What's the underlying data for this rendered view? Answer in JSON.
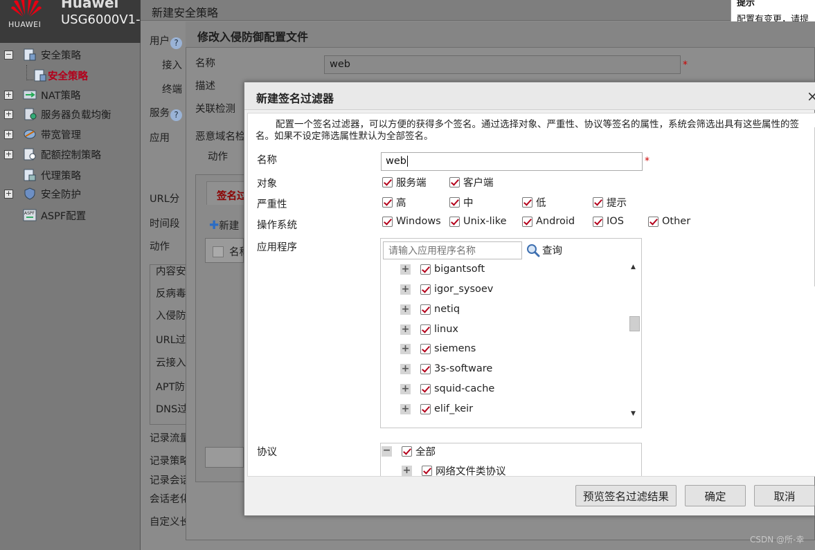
{
  "brand": {
    "logo_text": "HUAWEI",
    "name": "Huawei",
    "model": "USG6000V1-"
  },
  "hint": {
    "title": "提示",
    "text": "配置有变更，请提"
  },
  "sidebar": {
    "items": [
      {
        "label": "安全策略",
        "expand": "−"
      },
      {
        "label": "安全策略"
      },
      {
        "label": "NAT策略",
        "expand": "+"
      },
      {
        "label": "服务器负载均衡",
        "expand": "+"
      },
      {
        "label": "带宽管理",
        "expand": "+"
      },
      {
        "label": "配额控制策略",
        "expand": "+"
      },
      {
        "label": "代理策略"
      },
      {
        "label": "安全防护",
        "expand": "+"
      },
      {
        "label": "ASPF配置"
      }
    ]
  },
  "bg_page": {
    "title": "新建安全策略",
    "labels": [
      "用户",
      "接入",
      "终端",
      "服务",
      "应用",
      "URL分",
      "时间段",
      "动作",
      "内容安",
      "反病毒",
      "入侵防",
      "URL过",
      "云接入",
      "APT防",
      "DNS过",
      "记录流量",
      "记录策略",
      "记录会话",
      "会话老化",
      "自定义长"
    ],
    "help": "?",
    "tab": "签名过",
    "new_btn": "新建",
    "col": "名称"
  },
  "mid_dialog": {
    "title": "修改入侵防御配置文件",
    "labels": [
      "名称",
      "描述",
      "关联检测",
      "恶意域名检",
      "动作"
    ],
    "name_value": "web"
  },
  "dialog": {
    "title": "新建签名过滤器",
    "close": "×",
    "description": "配置一个签名过滤器，可以方便的获得多个签名。通过选择对象、严重性、协议等签名的属性，系统会筛选出具有这些属性的签名。如果不设定筛选属性默认为全部签名。",
    "name_label": "名称",
    "name_value": "web",
    "required": "*",
    "object_label": "对象",
    "objects": [
      "服务端",
      "客户端"
    ],
    "severity_label": "严重性",
    "severities": [
      "高",
      "中",
      "低",
      "提示"
    ],
    "os_label": "操作系统",
    "os": [
      "Windows",
      "Unix-like",
      "Android",
      "IOS",
      "Other"
    ],
    "app_label": "应用程序",
    "app_placeholder": "请输入应用程序名称",
    "search_label": "查询",
    "apps": [
      "bigantsoft",
      "igor_sysoev",
      "netiq",
      "linux",
      "siemens",
      "3s-software",
      "squid-cache",
      "elif_keir"
    ],
    "protocol_label": "协议",
    "protocols": [
      {
        "label": "全部",
        "sign": "−"
      },
      {
        "label": "网络文件类协议",
        "sign": "+"
      }
    ],
    "buttons": {
      "preview": "预览签名过滤结果",
      "ok": "确定",
      "cancel": "取消"
    }
  },
  "watermark": "CSDN @所-幸",
  "colors": {
    "check": "#b3001b",
    "selected_nav": "#b3001b"
  }
}
